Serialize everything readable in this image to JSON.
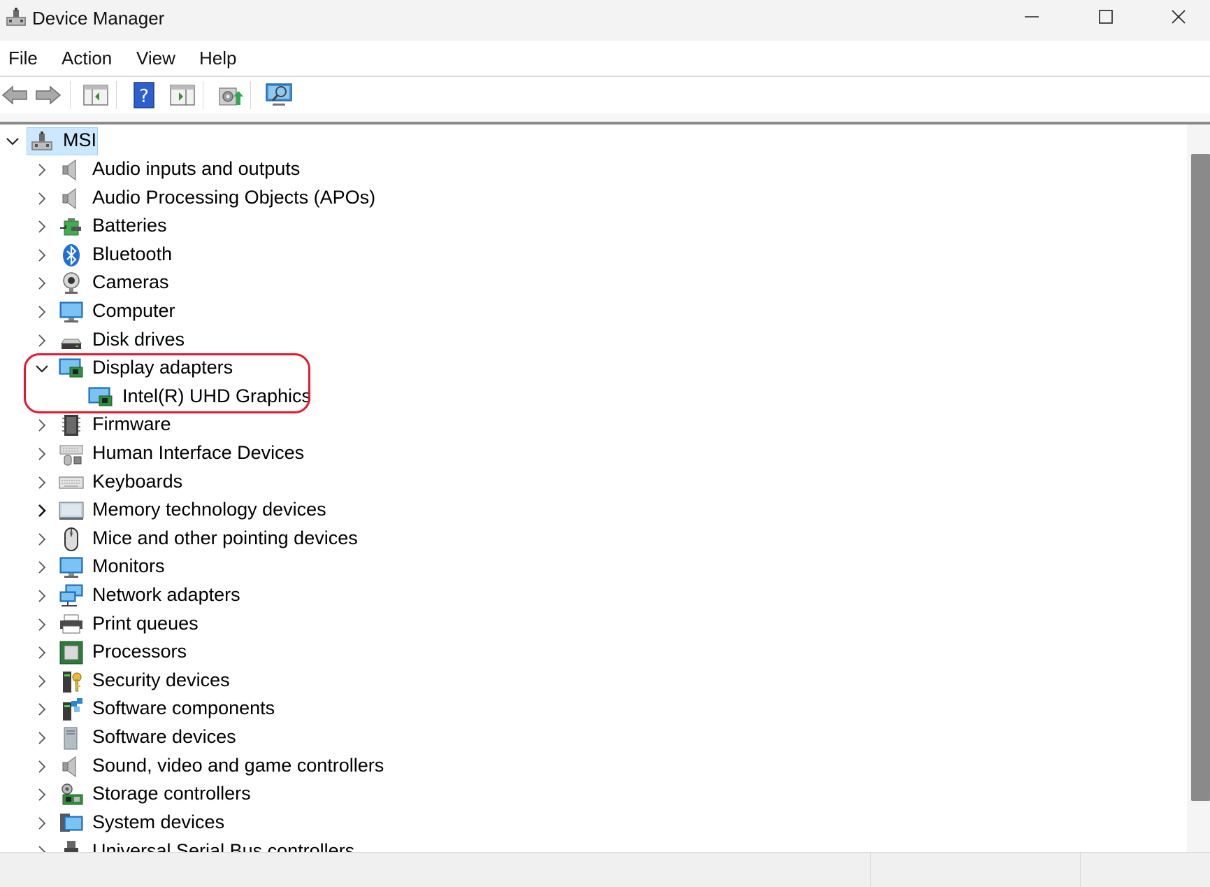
{
  "window": {
    "title": "Device Manager",
    "controls": [
      "minimize",
      "maximize",
      "close"
    ]
  },
  "menu": {
    "items": [
      "File",
      "Action",
      "View",
      "Help"
    ]
  },
  "toolbar": {
    "buttons": [
      {
        "name": "back-icon"
      },
      {
        "name": "forward-icon"
      },
      {
        "name": "show-hide-console-tree-icon"
      },
      {
        "name": "help-icon"
      },
      {
        "name": "show-action-pane-icon"
      },
      {
        "name": "update-driver-icon"
      },
      {
        "name": "scan-hardware-changes-icon"
      }
    ]
  },
  "tree": {
    "root": {
      "label": "MSI",
      "icon": "computer-root-icon",
      "expanded": true,
      "selected": true
    },
    "categories": [
      {
        "label": "Audio inputs and outputs",
        "icon": "speaker-icon",
        "expanded": false
      },
      {
        "label": "Audio Processing Objects (APOs)",
        "icon": "speaker-icon",
        "expanded": false
      },
      {
        "label": "Batteries",
        "icon": "battery-icon",
        "expanded": false
      },
      {
        "label": "Bluetooth",
        "icon": "bluetooth-icon",
        "expanded": false
      },
      {
        "label": "Cameras",
        "icon": "camera-icon",
        "expanded": false
      },
      {
        "label": "Computer",
        "icon": "monitor-icon",
        "expanded": false
      },
      {
        "label": "Disk drives",
        "icon": "disk-drive-icon",
        "expanded": false
      },
      {
        "label": "Display adapters",
        "icon": "display-adapter-icon",
        "expanded": true,
        "children": [
          {
            "label": "Intel(R) UHD Graphics",
            "icon": "display-adapter-icon"
          }
        ]
      },
      {
        "label": "Firmware",
        "icon": "firmware-icon",
        "expanded": false
      },
      {
        "label": "Human Interface Devices",
        "icon": "hid-icon",
        "expanded": false
      },
      {
        "label": "Keyboards",
        "icon": "keyboard-icon",
        "expanded": false
      },
      {
        "label": "Memory technology devices",
        "icon": "memory-icon",
        "expanded": false
      },
      {
        "label": "Mice and other pointing devices",
        "icon": "mouse-icon",
        "expanded": false
      },
      {
        "label": "Monitors",
        "icon": "monitor-icon",
        "expanded": false
      },
      {
        "label": "Network adapters",
        "icon": "network-icon",
        "expanded": false
      },
      {
        "label": "Print queues",
        "icon": "printer-icon",
        "expanded": false
      },
      {
        "label": "Processors",
        "icon": "processor-icon",
        "expanded": false
      },
      {
        "label": "Security devices",
        "icon": "security-key-icon",
        "expanded": false
      },
      {
        "label": "Software components",
        "icon": "software-component-icon",
        "expanded": false
      },
      {
        "label": "Software devices",
        "icon": "software-device-icon",
        "expanded": false
      },
      {
        "label": "Sound, video and game controllers",
        "icon": "speaker-icon",
        "expanded": false
      },
      {
        "label": "Storage controllers",
        "icon": "storage-controller-icon",
        "expanded": false
      },
      {
        "label": "System devices",
        "icon": "system-devices-icon",
        "expanded": false
      },
      {
        "label": "Universal Serial Bus controllers",
        "icon": "usb-icon",
        "expanded": false
      }
    ]
  },
  "annotation": {
    "color": "#e3182d",
    "target": "Display adapters"
  },
  "colors": {
    "selection": "#cce8ff",
    "accent": "#0078d4"
  }
}
